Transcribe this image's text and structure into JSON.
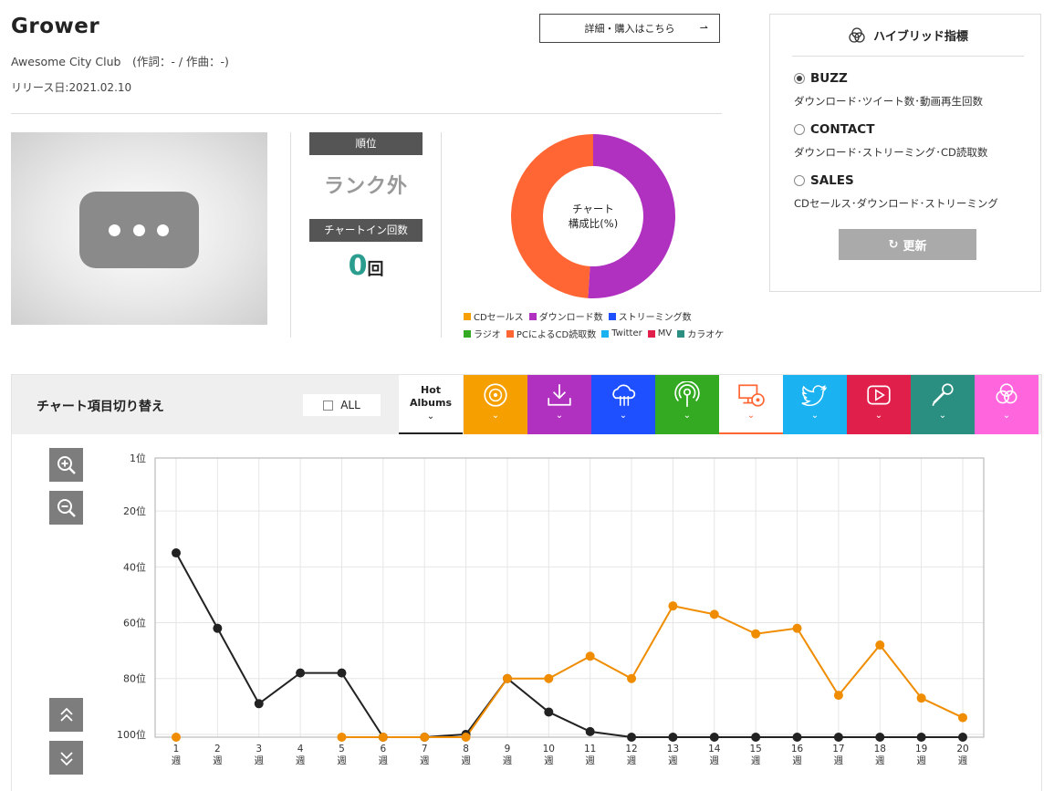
{
  "song": {
    "title": "Grower",
    "artist_line": "Awesome City Club　(作詞：- / 作曲：-)",
    "release": "リリース日:2021.02.10",
    "buy_label": "詳細・購入はこちら",
    "buy_arrow": "⇀"
  },
  "rank": {
    "label": "順位",
    "value": "ランク外",
    "chartin_label": "チャートイン回数",
    "chartin_count": "0",
    "chartin_unit": "回"
  },
  "donut": {
    "center_line1": "チャート",
    "center_line2": "構成比(%)",
    "segments": [
      {
        "name": "ダウンロード数",
        "value": 51,
        "color": "#b030c0"
      },
      {
        "name": "PCによるCD読取数",
        "value": 49,
        "color": "#ff6633"
      }
    ]
  },
  "legend_row1": [
    {
      "label": "CDセールス",
      "color": "#f5a000"
    },
    {
      "label": "ダウンロード数",
      "color": "#b030c0"
    },
    {
      "label": "ストリーミング数",
      "color": "#1e50ff"
    }
  ],
  "legend_row2": [
    {
      "label": "ラジオ",
      "color": "#33aa22"
    },
    {
      "label": "PCによるCD読取数",
      "color": "#ff6633"
    },
    {
      "label": "Twitter",
      "color": "#1ab2f0"
    },
    {
      "label": "MV",
      "color": "#e0204a"
    },
    {
      "label": "カラオケ",
      "color": "#2a8f80"
    }
  ],
  "hybrid": {
    "title": "ハイブリッド指標",
    "options": [
      {
        "name": "BUZZ",
        "desc": "ダウンロード･ツイート数･動画再生回数",
        "selected": true
      },
      {
        "name": "CONTACT",
        "desc": "ダウンロード･ストリーミング･CD読取数",
        "selected": false
      },
      {
        "name": "SALES",
        "desc": "CDセールス･ダウンロード･ストリーミング",
        "selected": false
      }
    ],
    "refresh_label": "更新"
  },
  "switcher": {
    "label": "チャート項目切り替え",
    "all_label": "ALL",
    "hot_line1": "Hot",
    "hot_line2": "Albums",
    "tabs": [
      {
        "icon": "cd-icon",
        "color": "#f5a000"
      },
      {
        "icon": "download-icon",
        "color": "#b030c0"
      },
      {
        "icon": "streaming-icon",
        "color": "#1e50ff"
      },
      {
        "icon": "radio-icon",
        "color": "#33aa22"
      },
      {
        "icon": "pc-cd-icon",
        "color": "#ffffff"
      },
      {
        "icon": "twitter-icon",
        "color": "#1ab2f0"
      },
      {
        "icon": "mv-icon",
        "color": "#e0204a"
      },
      {
        "icon": "karaoke-icon",
        "color": "#2a8f80"
      },
      {
        "icon": "hybrid-icon",
        "color": "#ff66dd"
      }
    ]
  },
  "chart_data": {
    "type": "line",
    "x": [
      "1\n週",
      "2\n週",
      "3\n週",
      "4\n週",
      "5\n週",
      "6\n週",
      "7\n週",
      "8\n週",
      "9\n週",
      "10\n週",
      "11\n週",
      "12\n週",
      "13\n週",
      "14\n週",
      "15\n週",
      "16\n週",
      "17\n週",
      "18\n週",
      "19\n週",
      "20\n週"
    ],
    "yticks": [
      {
        "value": 1,
        "label": "1位"
      },
      {
        "value": 20,
        "label": "20位"
      },
      {
        "value": 40,
        "label": "40位"
      },
      {
        "value": 60,
        "label": "60位"
      },
      {
        "value": 80,
        "label": "80位"
      },
      {
        "value": 100,
        "label": "100位"
      }
    ],
    "ylim": [
      1,
      101
    ],
    "y_inverted": true,
    "grid": true,
    "series": [
      {
        "color": "#222222",
        "values": [
          35,
          62,
          89,
          78,
          78,
          101,
          101,
          100,
          80,
          92,
          99,
          101,
          101,
          101,
          101,
          101,
          101,
          101,
          101,
          101
        ]
      },
      {
        "color": "#f08c00",
        "values": [
          101,
          null,
          null,
          null,
          101,
          101,
          101,
          101,
          80,
          80,
          72,
          80,
          54,
          57,
          64,
          62,
          86,
          68,
          87,
          94
        ]
      }
    ]
  }
}
